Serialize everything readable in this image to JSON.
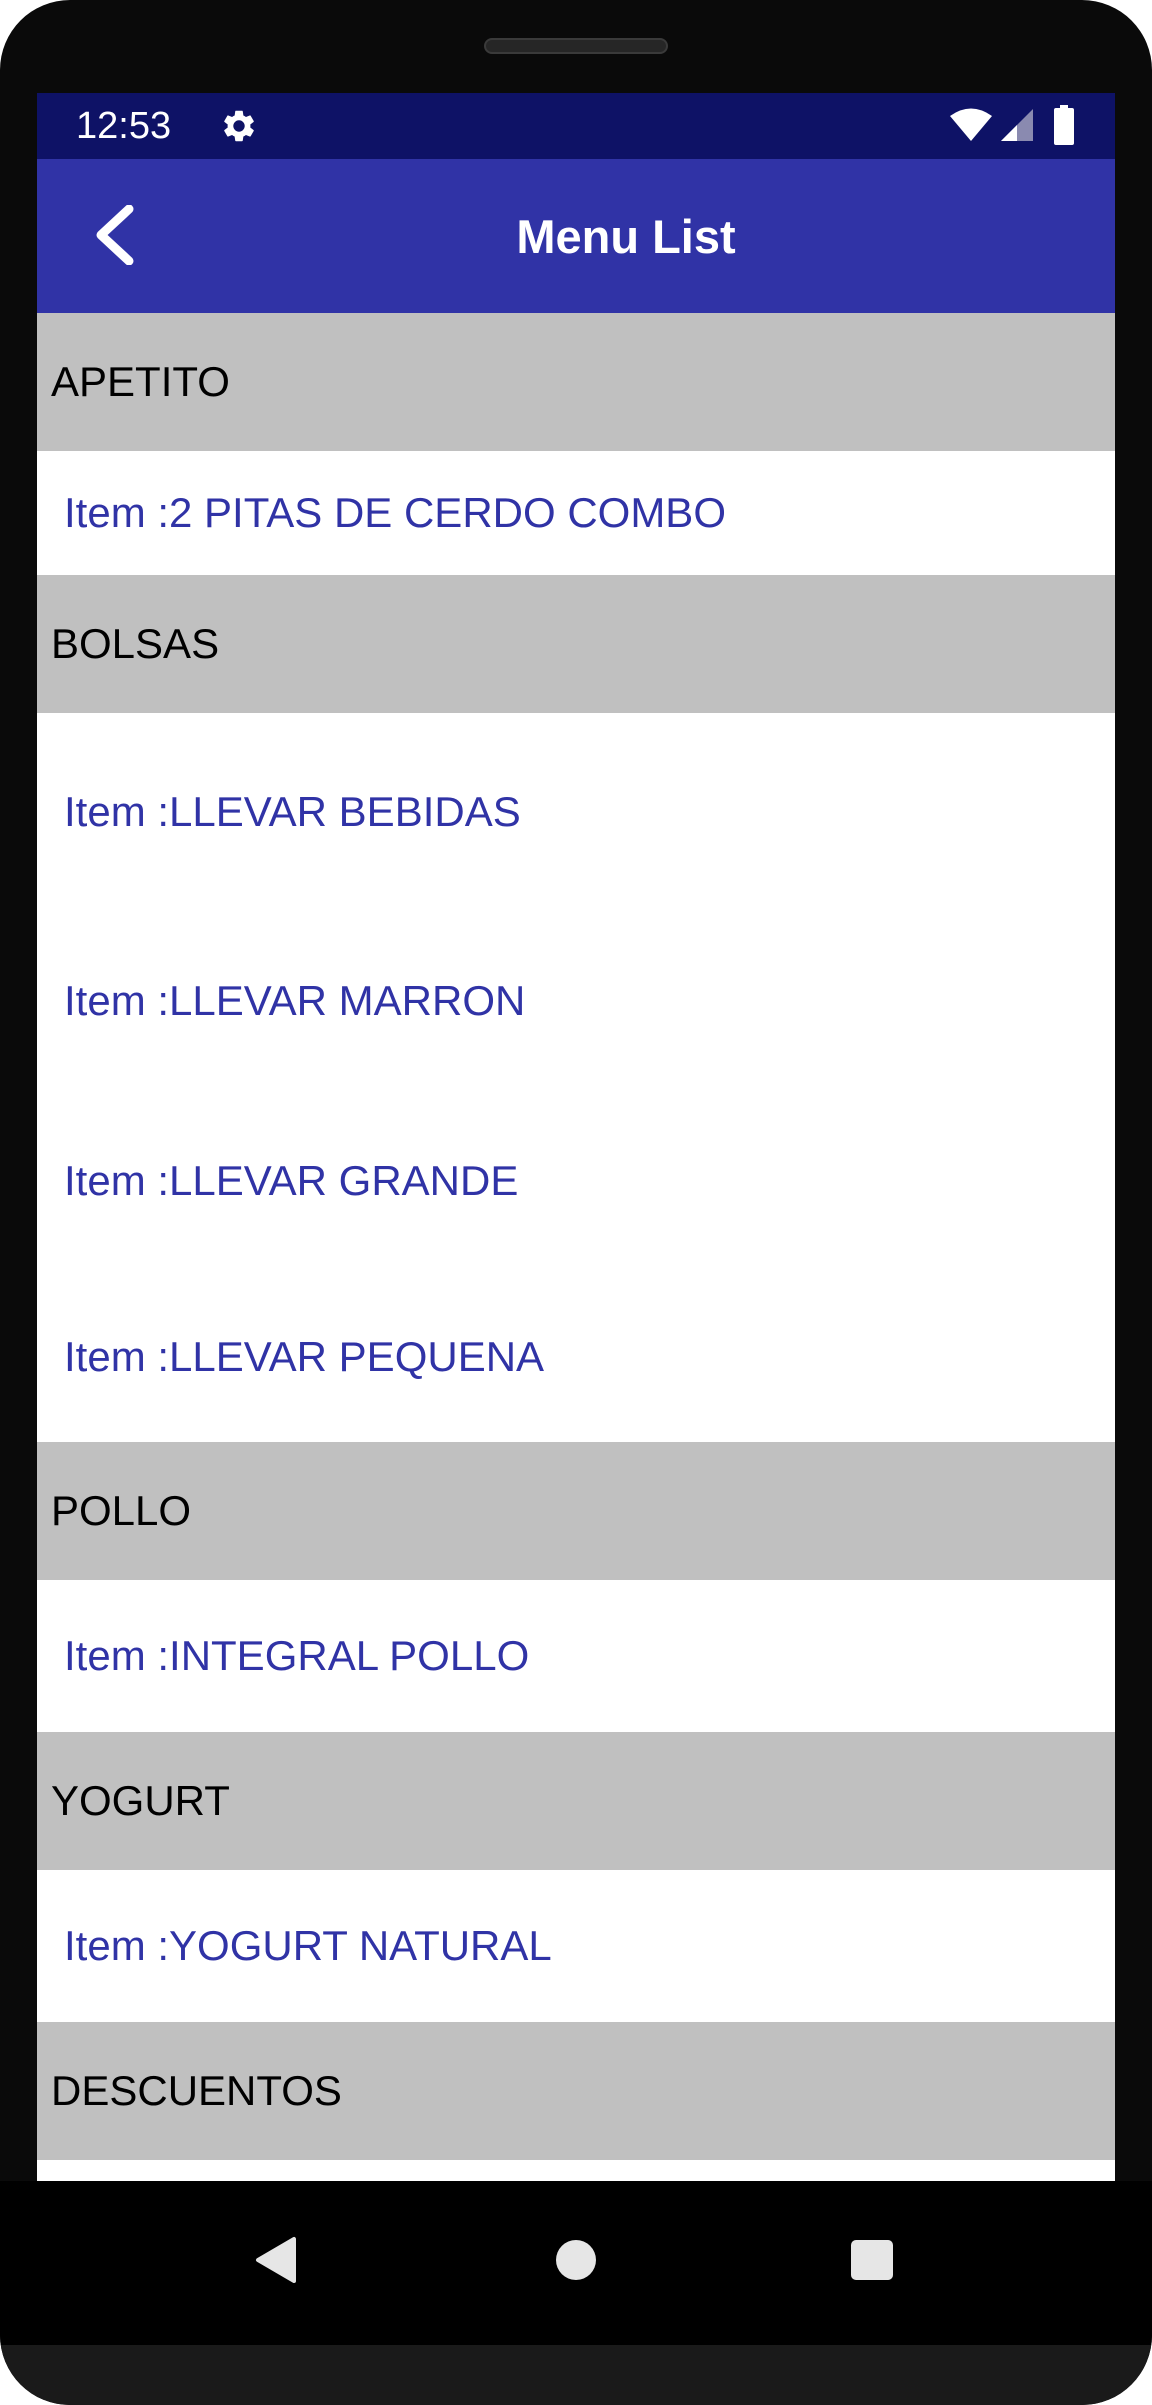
{
  "status_bar": {
    "time": "12:53",
    "icons": [
      "gear-icon",
      "wifi-icon",
      "cellular-signal-icon",
      "battery-icon"
    ]
  },
  "app_bar": {
    "title": "Menu List",
    "back_icon": "chevron-left-icon"
  },
  "menu": {
    "sections": [
      {
        "name": "APETITO",
        "items": [
          "Item :2 PITAS DE CERDO COMBO"
        ]
      },
      {
        "name": "BOLSAS",
        "items": [
          "Item :LLEVAR BEBIDAS",
          "Item :LLEVAR MARRON",
          "Item :LLEVAR GRANDE",
          "Item :LLEVAR PEQUENA"
        ]
      },
      {
        "name": "POLLO",
        "items": [
          "Item :INTEGRAL POLLO"
        ]
      },
      {
        "name": "YOGURT",
        "items": [
          "Item :YOGURT NATURAL"
        ]
      },
      {
        "name": "DESCUENTOS",
        "items": []
      }
    ]
  },
  "nav_bar": {
    "buttons": [
      "back-triangle-icon",
      "home-circle-icon",
      "recents-square-icon"
    ]
  },
  "colors": {
    "status_bar": "#0e1266",
    "app_bar": "#3033a6",
    "section_header": "#c0c0c0",
    "item_text": "#3033a6"
  }
}
